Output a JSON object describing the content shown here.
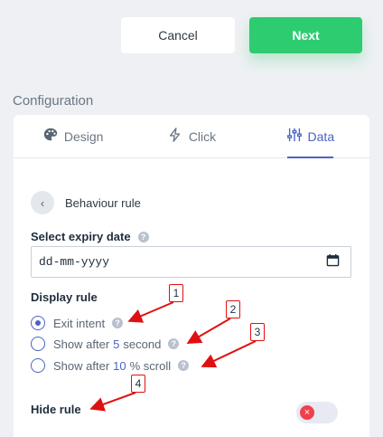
{
  "buttons": {
    "cancel": "Cancel",
    "next": "Next"
  },
  "section": {
    "title": "Configuration"
  },
  "tabs": [
    {
      "label": "Design",
      "icon": "palette-icon"
    },
    {
      "label": "Click",
      "icon": "lightning-icon"
    },
    {
      "label": "Data",
      "icon": "sliders-icon",
      "active": true
    }
  ],
  "header": {
    "back_label": "Behaviour rule",
    "back_icon": "chevron-left-icon"
  },
  "expiry": {
    "label": "Select expiry date",
    "placeholder": "dd-mm-yyyy",
    "icon": "calendar-icon"
  },
  "display_rule": {
    "label": "Display rule",
    "options": [
      {
        "label": "Exit intent",
        "checked": true
      },
      {
        "prefix": "Show after",
        "value": "5",
        "suffix": "second",
        "checked": false
      },
      {
        "prefix": "Show after",
        "value": "10",
        "suffix": "% scroll",
        "checked": false
      }
    ]
  },
  "hide_rule": {
    "label": "Hide rule",
    "toggle_on": false,
    "toggle_icon": "close-icon"
  },
  "annotations": [
    "1",
    "2",
    "3",
    "4"
  ],
  "colors": {
    "accent": "#4a63c7",
    "primary": "#2ecc71",
    "annotation": "#e01010",
    "toggle_off": "#f0404a"
  }
}
